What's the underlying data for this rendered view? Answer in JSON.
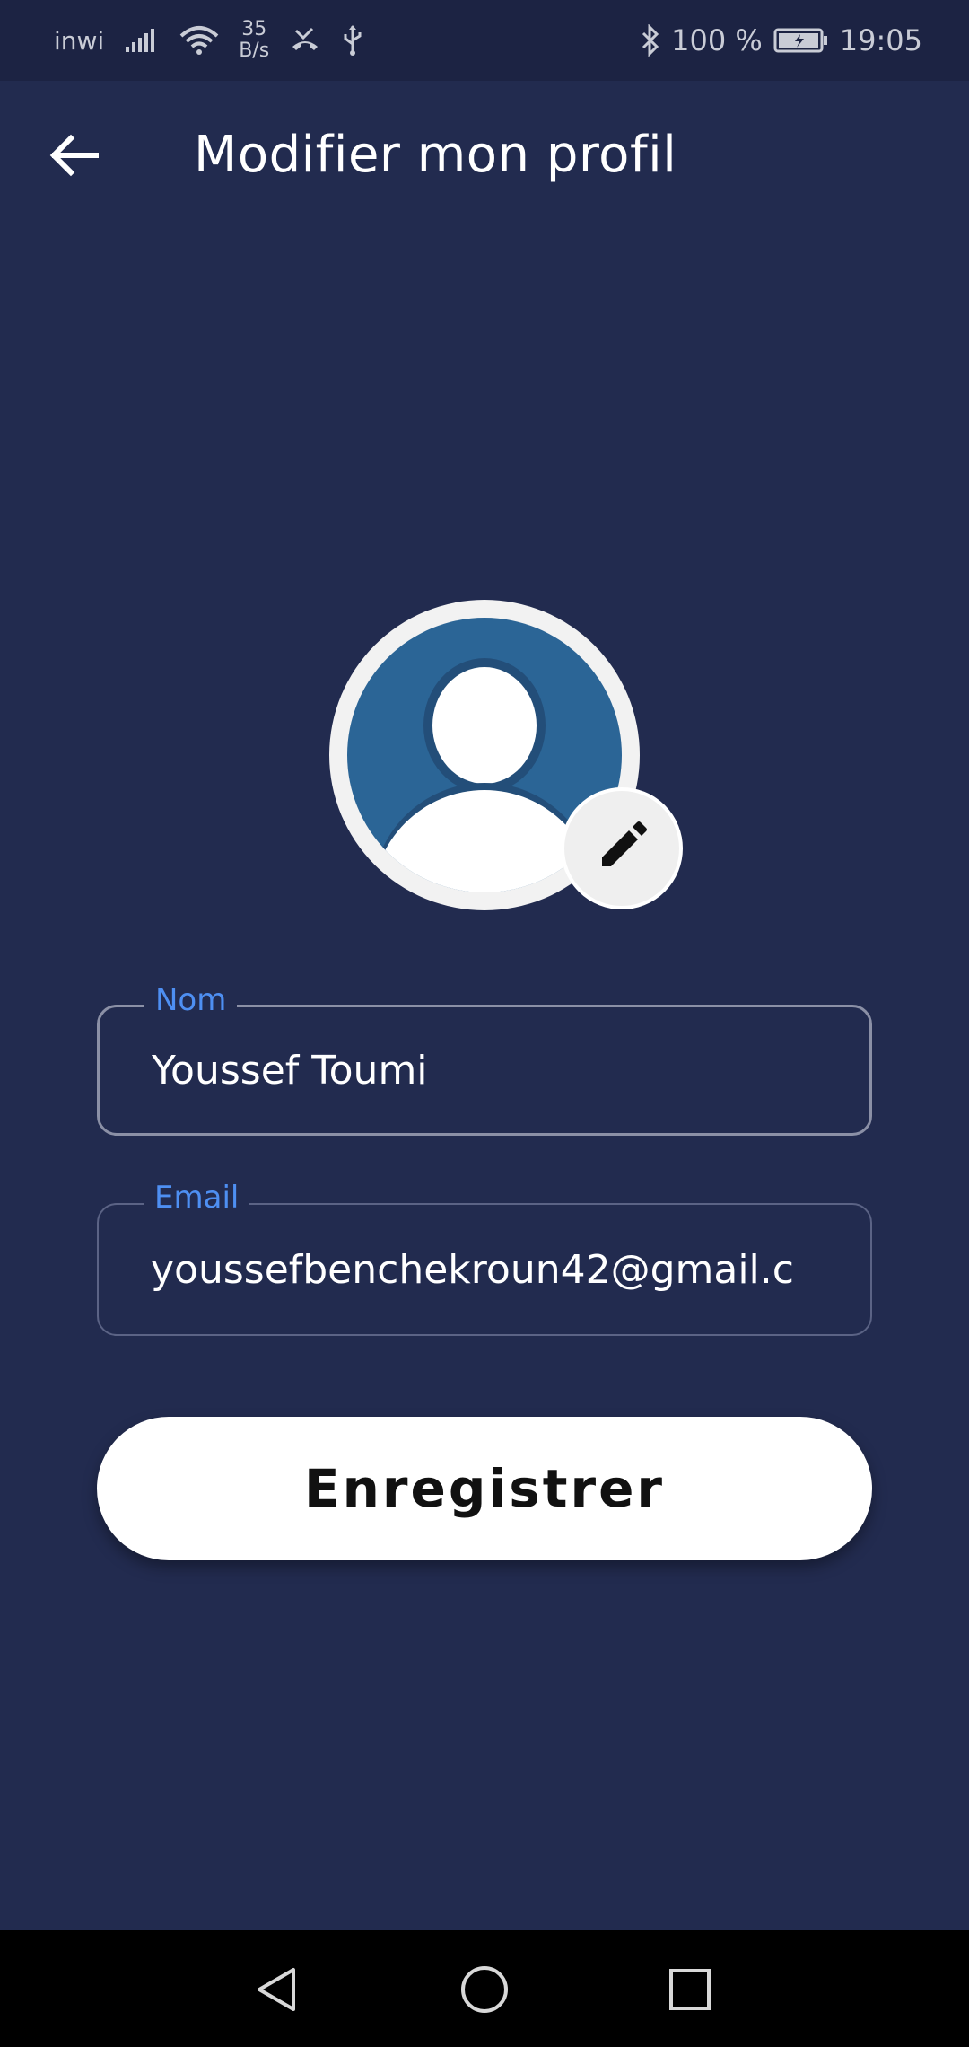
{
  "status_bar": {
    "carrier": "inwi",
    "net_speed_value": "35",
    "net_speed_unit": "B/s",
    "battery": "100 %",
    "time": "19:05"
  },
  "header": {
    "title": "Modifier mon profil",
    "back_icon": "arrow-left-icon"
  },
  "avatar": {
    "icon": "user-placeholder-icon",
    "edit_icon": "pencil-icon"
  },
  "form": {
    "name_field": {
      "label": "Nom",
      "value": "Youssef Toumi"
    },
    "email_field": {
      "label": "Email",
      "value": "youssefbenchekroun42@gmail.c"
    },
    "save_label": "Enregistrer"
  },
  "colors": {
    "background": "#222b4f",
    "status_bar": "#1c2343",
    "accent_label": "#4e8ff2",
    "avatar_bg": "#2b6596",
    "button_bg": "#ffffff"
  }
}
